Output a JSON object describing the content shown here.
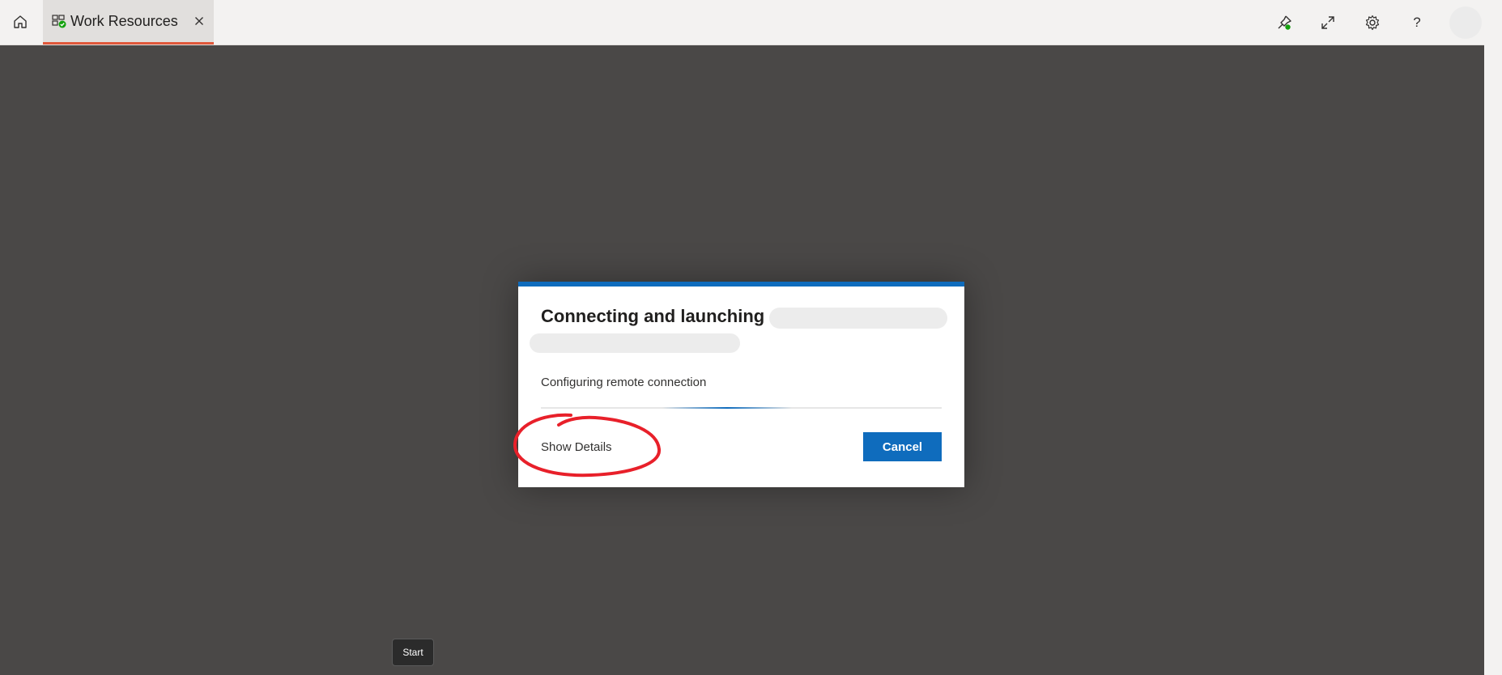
{
  "tabs": [
    {
      "label": "Work Resources",
      "active": true,
      "accent": "#e0573a"
    }
  ],
  "toolbar": {
    "icons": [
      "pin-icon",
      "expand-icon",
      "gear-icon",
      "help-icon"
    ],
    "help_glyph": "?"
  },
  "dialog": {
    "title": "Connecting and launching",
    "status": "Configuring remote connection",
    "details_label": "Show Details",
    "cancel_label": "Cancel",
    "accent": "#0f6cbd"
  },
  "annotation": {
    "color": "#e8202a"
  },
  "tooltip": {
    "label": "Start"
  }
}
